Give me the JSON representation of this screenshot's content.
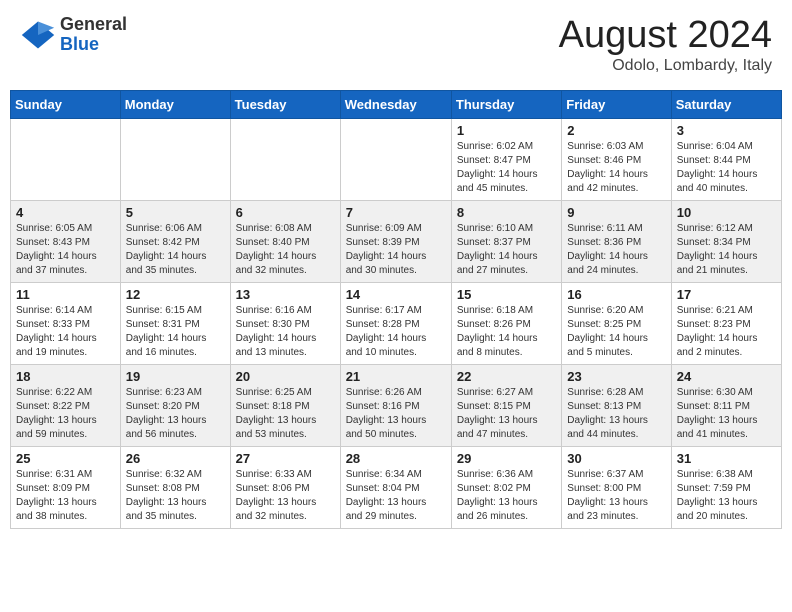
{
  "header": {
    "logo_general": "General",
    "logo_blue": "Blue",
    "month_title": "August 2024",
    "location": "Odolo, Lombardy, Italy"
  },
  "weekdays": [
    "Sunday",
    "Monday",
    "Tuesday",
    "Wednesday",
    "Thursday",
    "Friday",
    "Saturday"
  ],
  "weeks": [
    [
      {
        "num": "",
        "info": ""
      },
      {
        "num": "",
        "info": ""
      },
      {
        "num": "",
        "info": ""
      },
      {
        "num": "",
        "info": ""
      },
      {
        "num": "1",
        "info": "Sunrise: 6:02 AM\nSunset: 8:47 PM\nDaylight: 14 hours\nand 45 minutes."
      },
      {
        "num": "2",
        "info": "Sunrise: 6:03 AM\nSunset: 8:46 PM\nDaylight: 14 hours\nand 42 minutes."
      },
      {
        "num": "3",
        "info": "Sunrise: 6:04 AM\nSunset: 8:44 PM\nDaylight: 14 hours\nand 40 minutes."
      }
    ],
    [
      {
        "num": "4",
        "info": "Sunrise: 6:05 AM\nSunset: 8:43 PM\nDaylight: 14 hours\nand 37 minutes."
      },
      {
        "num": "5",
        "info": "Sunrise: 6:06 AM\nSunset: 8:42 PM\nDaylight: 14 hours\nand 35 minutes."
      },
      {
        "num": "6",
        "info": "Sunrise: 6:08 AM\nSunset: 8:40 PM\nDaylight: 14 hours\nand 32 minutes."
      },
      {
        "num": "7",
        "info": "Sunrise: 6:09 AM\nSunset: 8:39 PM\nDaylight: 14 hours\nand 30 minutes."
      },
      {
        "num": "8",
        "info": "Sunrise: 6:10 AM\nSunset: 8:37 PM\nDaylight: 14 hours\nand 27 minutes."
      },
      {
        "num": "9",
        "info": "Sunrise: 6:11 AM\nSunset: 8:36 PM\nDaylight: 14 hours\nand 24 minutes."
      },
      {
        "num": "10",
        "info": "Sunrise: 6:12 AM\nSunset: 8:34 PM\nDaylight: 14 hours\nand 21 minutes."
      }
    ],
    [
      {
        "num": "11",
        "info": "Sunrise: 6:14 AM\nSunset: 8:33 PM\nDaylight: 14 hours\nand 19 minutes."
      },
      {
        "num": "12",
        "info": "Sunrise: 6:15 AM\nSunset: 8:31 PM\nDaylight: 14 hours\nand 16 minutes."
      },
      {
        "num": "13",
        "info": "Sunrise: 6:16 AM\nSunset: 8:30 PM\nDaylight: 14 hours\nand 13 minutes."
      },
      {
        "num": "14",
        "info": "Sunrise: 6:17 AM\nSunset: 8:28 PM\nDaylight: 14 hours\nand 10 minutes."
      },
      {
        "num": "15",
        "info": "Sunrise: 6:18 AM\nSunset: 8:26 PM\nDaylight: 14 hours\nand 8 minutes."
      },
      {
        "num": "16",
        "info": "Sunrise: 6:20 AM\nSunset: 8:25 PM\nDaylight: 14 hours\nand 5 minutes."
      },
      {
        "num": "17",
        "info": "Sunrise: 6:21 AM\nSunset: 8:23 PM\nDaylight: 14 hours\nand 2 minutes."
      }
    ],
    [
      {
        "num": "18",
        "info": "Sunrise: 6:22 AM\nSunset: 8:22 PM\nDaylight: 13 hours\nand 59 minutes."
      },
      {
        "num": "19",
        "info": "Sunrise: 6:23 AM\nSunset: 8:20 PM\nDaylight: 13 hours\nand 56 minutes."
      },
      {
        "num": "20",
        "info": "Sunrise: 6:25 AM\nSunset: 8:18 PM\nDaylight: 13 hours\nand 53 minutes."
      },
      {
        "num": "21",
        "info": "Sunrise: 6:26 AM\nSunset: 8:16 PM\nDaylight: 13 hours\nand 50 minutes."
      },
      {
        "num": "22",
        "info": "Sunrise: 6:27 AM\nSunset: 8:15 PM\nDaylight: 13 hours\nand 47 minutes."
      },
      {
        "num": "23",
        "info": "Sunrise: 6:28 AM\nSunset: 8:13 PM\nDaylight: 13 hours\nand 44 minutes."
      },
      {
        "num": "24",
        "info": "Sunrise: 6:30 AM\nSunset: 8:11 PM\nDaylight: 13 hours\nand 41 minutes."
      }
    ],
    [
      {
        "num": "25",
        "info": "Sunrise: 6:31 AM\nSunset: 8:09 PM\nDaylight: 13 hours\nand 38 minutes."
      },
      {
        "num": "26",
        "info": "Sunrise: 6:32 AM\nSunset: 8:08 PM\nDaylight: 13 hours\nand 35 minutes."
      },
      {
        "num": "27",
        "info": "Sunrise: 6:33 AM\nSunset: 8:06 PM\nDaylight: 13 hours\nand 32 minutes."
      },
      {
        "num": "28",
        "info": "Sunrise: 6:34 AM\nSunset: 8:04 PM\nDaylight: 13 hours\nand 29 minutes."
      },
      {
        "num": "29",
        "info": "Sunrise: 6:36 AM\nSunset: 8:02 PM\nDaylight: 13 hours\nand 26 minutes."
      },
      {
        "num": "30",
        "info": "Sunrise: 6:37 AM\nSunset: 8:00 PM\nDaylight: 13 hours\nand 23 minutes."
      },
      {
        "num": "31",
        "info": "Sunrise: 6:38 AM\nSunset: 7:59 PM\nDaylight: 13 hours\nand 20 minutes."
      }
    ]
  ]
}
